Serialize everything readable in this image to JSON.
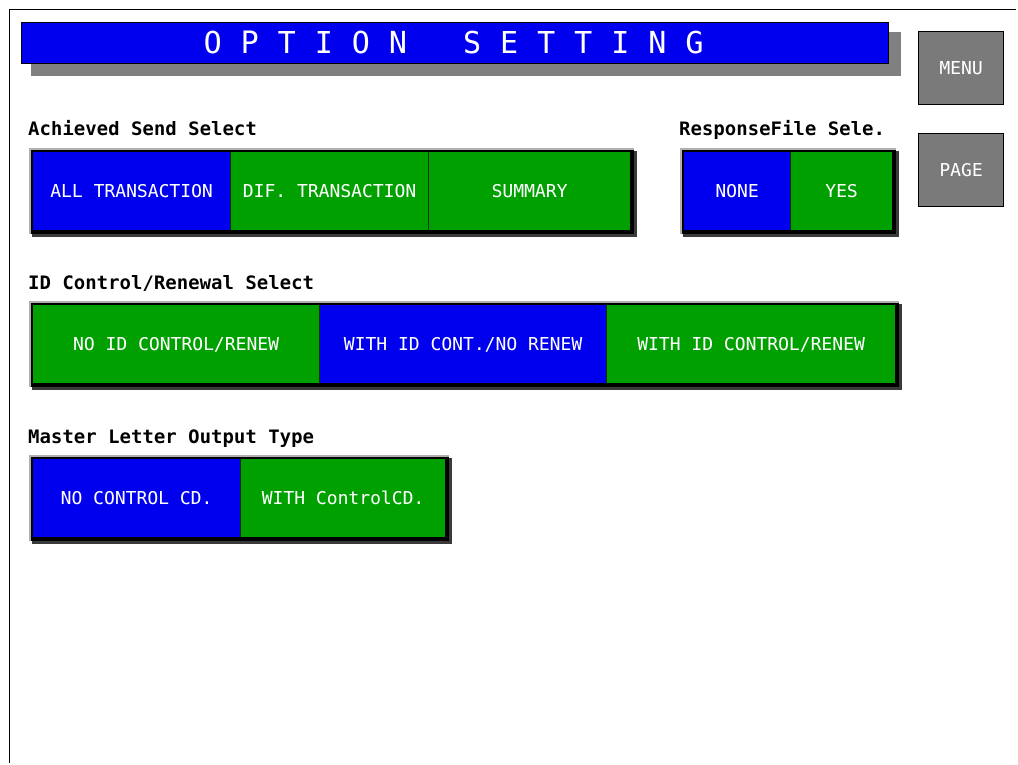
{
  "title": "OPTION SETTING",
  "side_buttons": {
    "menu": "MENU",
    "page": "PAGE"
  },
  "achieved_send": {
    "label": "Achieved Send Select",
    "options": [
      "ALL TRANSACTION",
      "DIF. TRANSACTION",
      "SUMMARY"
    ],
    "selected_index": 0
  },
  "response_file": {
    "label": "ResponseFile Sele.",
    "options": [
      "NONE",
      "YES"
    ],
    "selected_index": 0
  },
  "id_control": {
    "label": "ID Control/Renewal Select",
    "options": [
      "NO ID CONTROL/RENEW",
      "WITH ID CONT./NO RENEW",
      "WITH ID CONTROL/RENEW"
    ],
    "selected_index": 1
  },
  "master_letter": {
    "label": "Master Letter Output Type",
    "options": [
      "NO CONTROL CD.",
      "WITH ControlCD."
    ],
    "selected_index": 0
  },
  "colors": {
    "selected": "#0000ee",
    "unselected": "#00a000",
    "side_button": "#7a7a7a"
  }
}
